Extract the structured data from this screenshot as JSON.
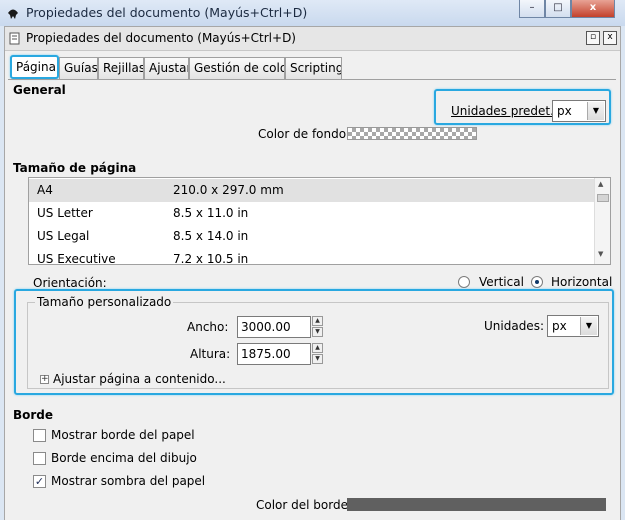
{
  "window": {
    "title": "Propiedades del documento (Mayús+Ctrl+D)",
    "minimize_glyph": "–",
    "maximize_glyph": "□",
    "close_glyph": "x"
  },
  "panel": {
    "title": "Propiedades del documento (Mayús+Ctrl+D)",
    "detach_glyph": "▫",
    "close_glyph": "x"
  },
  "tabs": [
    {
      "label": "Página",
      "active": true
    },
    {
      "label": "Guías"
    },
    {
      "label": "Rejillas"
    },
    {
      "label": "Ajustar"
    },
    {
      "label": "Gestión de color"
    },
    {
      "label": "Scripting"
    }
  ],
  "general": {
    "heading": "General",
    "units_label": "Unidades predet.:",
    "units_value": "px",
    "background_color_label": "Color de fondo:"
  },
  "page_size": {
    "heading": "Tamaño de página",
    "rows": [
      {
        "name": "A4",
        "size": "210.0 x 297.0 mm",
        "selected": true
      },
      {
        "name": "US Letter",
        "size": "8.5 x 11.0 in"
      },
      {
        "name": "US Legal",
        "size": "8.5 x 14.0 in"
      },
      {
        "name": "US Executive",
        "size": "7.2 x 10.5 in"
      }
    ],
    "orientation_label": "Orientación:",
    "orientation_options": [
      "Vertical",
      "Horizontal"
    ],
    "orientation_selected": "Horizontal"
  },
  "custom_size": {
    "legend": "Tamaño personalizado",
    "width_label": "Ancho:",
    "width_value": "3000.00",
    "height_label": "Altura:",
    "height_value": "1875.00",
    "units_label": "Unidades:",
    "units_value": "px",
    "fit_label": "Ajustar página a contenido...",
    "fit_expander_glyph": "+"
  },
  "border": {
    "heading": "Borde",
    "show_border_label": "Mostrar borde del papel",
    "show_border_checked": false,
    "border_on_top_label": "Borde encima del dibujo",
    "border_on_top_checked": false,
    "show_shadow_label": "Mostrar sombra del papel",
    "show_shadow_checked": true,
    "check_glyph": "✓",
    "border_color_label": "Color del borde:",
    "border_color": "#606060"
  },
  "glyphs": {
    "dropdown": "▼",
    "spin_up": "▲",
    "spin_down": "▼",
    "scroll_up": "▲",
    "scroll_down": "▼"
  },
  "colors": {
    "highlight": "#29a8e0",
    "titlebar": "#c9d9ee"
  }
}
